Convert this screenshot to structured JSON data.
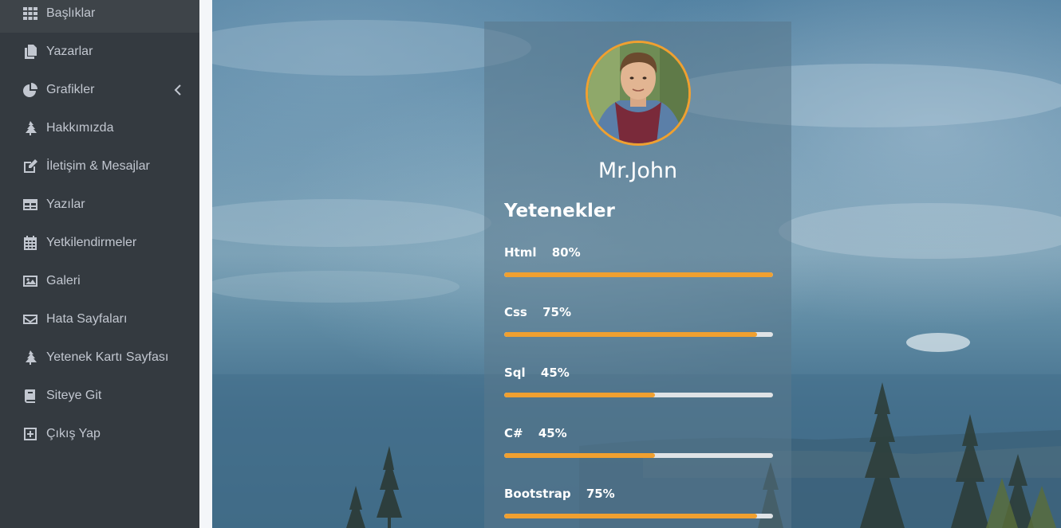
{
  "sidebar": {
    "items": [
      {
        "label": "Başlıklar",
        "icon": "grid-icon"
      },
      {
        "label": "Yazarlar",
        "icon": "copy-icon"
      },
      {
        "label": "Grafikler",
        "icon": "pie-chart-icon",
        "has_submenu": true
      },
      {
        "label": "Hakkımızda",
        "icon": "tree-icon"
      },
      {
        "label": "İletişim & Mesajlar",
        "icon": "edit-icon"
      },
      {
        "label": "Yazılar",
        "icon": "table-icon"
      },
      {
        "label": "Yetkilendirmeler",
        "icon": "calendar-icon"
      },
      {
        "label": "Galeri",
        "icon": "image-icon"
      },
      {
        "label": "Hata Sayfaları",
        "icon": "envelope-icon"
      },
      {
        "label": "Yetenek Kartı Sayfası",
        "icon": "tree-icon"
      },
      {
        "label": "Siteye Git",
        "icon": "book-icon"
      },
      {
        "label": "Çıkış Yap",
        "icon": "plus-square-icon"
      }
    ]
  },
  "card": {
    "name": "Mr.John",
    "skills_title": "Yetenekler",
    "skills": [
      {
        "name": "Html",
        "percent_label": "80%",
        "fill": 1.0
      },
      {
        "name": "Css",
        "percent_label": "75%",
        "fill": 0.94
      },
      {
        "name": "Sql",
        "percent_label": "45%",
        "fill": 0.56
      },
      {
        "name": "C#",
        "percent_label": "45%",
        "fill": 0.56
      },
      {
        "name": "Bootstrap",
        "percent_label": "75%",
        "fill": 0.94
      }
    ]
  },
  "colors": {
    "sidebar_bg": "#343a40",
    "sidebar_text": "#c2c7d0",
    "accent": "#f0a030",
    "track": "#dfe3e6"
  }
}
